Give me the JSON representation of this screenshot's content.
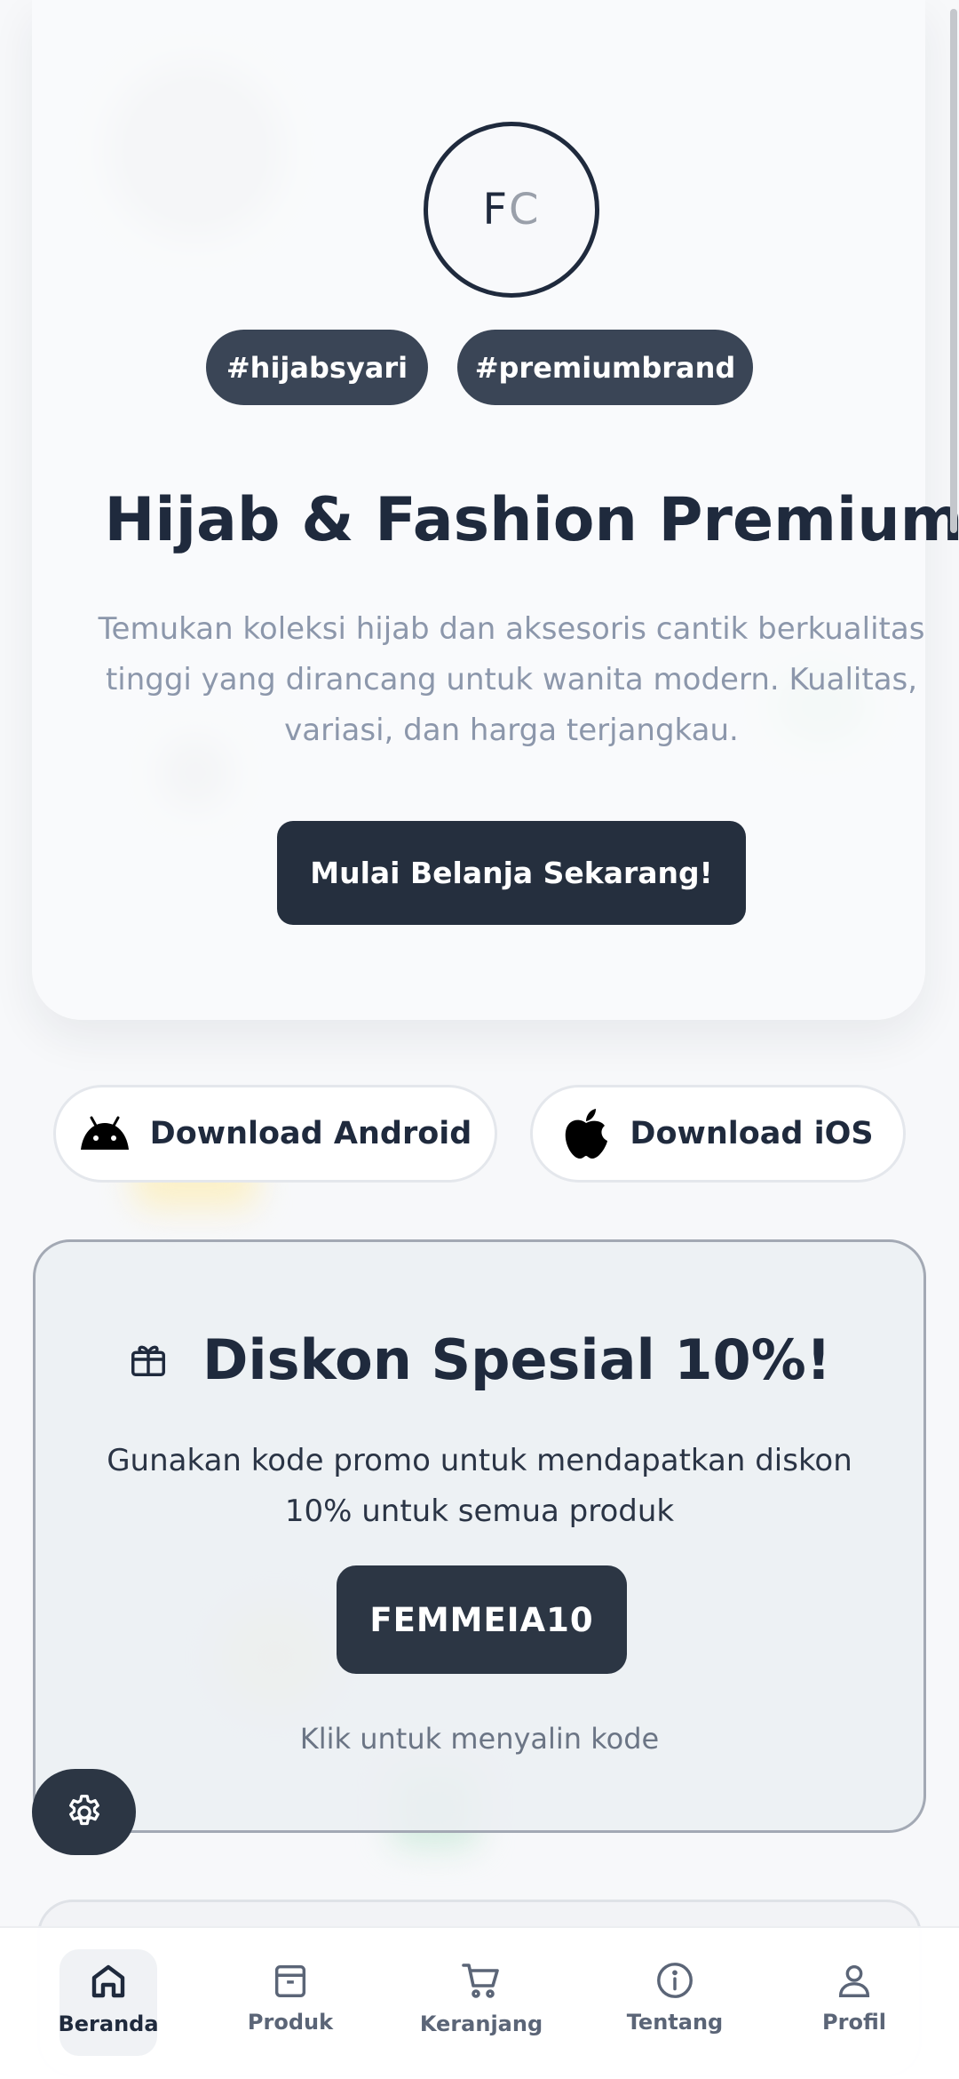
{
  "colors": {
    "primary_dark": "#252f3e",
    "tag_bg": "#3a4556",
    "muted_text": "#8c97ab",
    "background": "#f7f8fa"
  },
  "hero": {
    "logo_text_left": "F",
    "logo_text_right": "C",
    "tags": [
      "#hijabsyari",
      "#premiumbrand"
    ],
    "title_icon": "star-outline-icon",
    "title": "Hijab & Fashion Premium",
    "description": "Temukan koleksi hijab dan aksesoris cantik berkualitas tinggi yang dirancang untuk wanita modern. Kualitas, variasi, dan harga terjangkau.",
    "cta_label": "Mulai Belanja Sekarang!"
  },
  "downloads": {
    "android": {
      "icon": "android-icon",
      "label": "Download Android"
    },
    "ios": {
      "icon": "apple-icon",
      "label": "Download iOS"
    }
  },
  "promo": {
    "icon": "gift-icon",
    "title": "Diskon Spesial 10%!",
    "description": "Gunakan kode promo untuk mendapatkan diskon 10% untuk semua produk",
    "code": "FEMMEIA10",
    "hint": "Klik untuk menyalin kode"
  },
  "settings_fab": {
    "icon": "gear-icon"
  },
  "bottom_nav": {
    "active": "Beranda",
    "items": [
      {
        "label": "Beranda",
        "icon": "home-icon"
      },
      {
        "label": "Produk",
        "icon": "box-icon"
      },
      {
        "label": "Keranjang",
        "icon": "cart-icon"
      },
      {
        "label": "Tentang",
        "icon": "info-icon"
      },
      {
        "label": "Profil",
        "icon": "user-icon"
      }
    ]
  }
}
